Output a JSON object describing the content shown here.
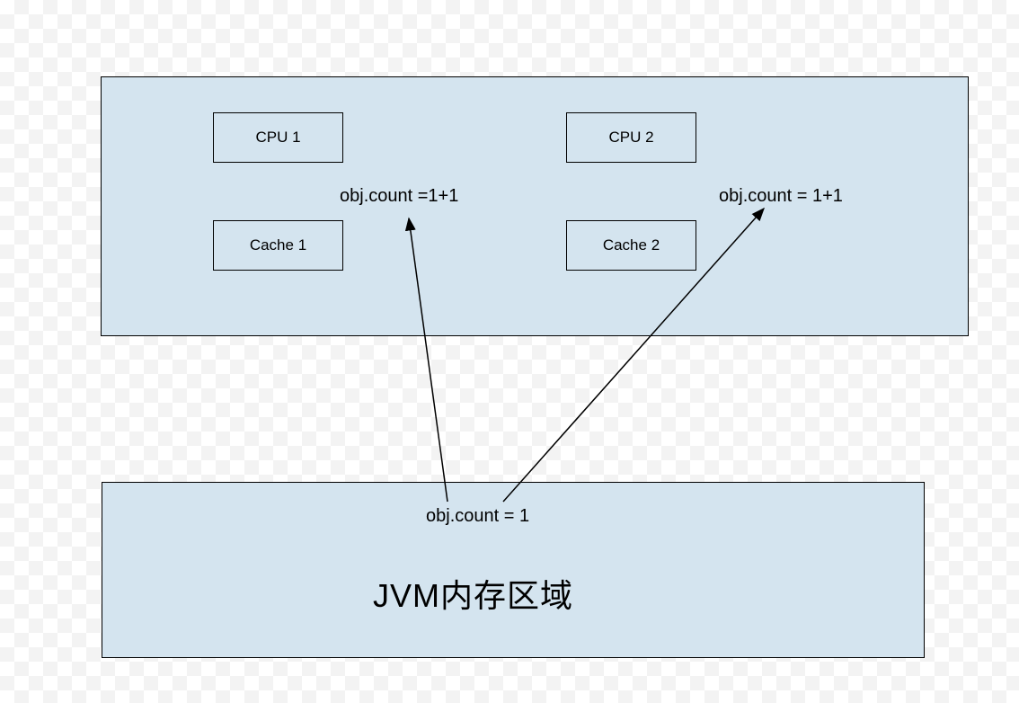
{
  "diagram": {
    "cpu1_label": "CPU  1",
    "cpu2_label": "CPU  2",
    "cache1_label": "Cache 1",
    "cache2_label": "Cache 2",
    "obj_count_cpu1": "obj.count =1+1",
    "obj_count_cpu2": "obj.count = 1+1",
    "obj_count_memory": "obj.count = 1",
    "jvm_label": "JVM内存区域"
  },
  "colors": {
    "box_fill": "#d4e4ef",
    "box_border": "#000000"
  }
}
